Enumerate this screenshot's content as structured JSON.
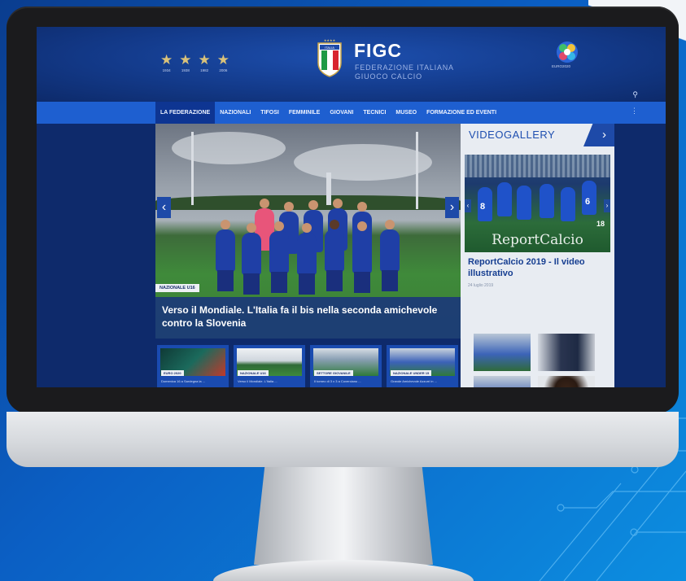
{
  "site": {
    "title": "FIGC",
    "subtitle_line1": "FEDERAZIONE ITALIANA",
    "subtitle_line2": "GIUOCO CALCIO",
    "shield_text": "ITALIA",
    "stars": [
      {
        "year": "1934"
      },
      {
        "year": "1938"
      },
      {
        "year": "1982"
      },
      {
        "year": "2006"
      }
    ],
    "euro_label": "EURO2020",
    "colors": {
      "primary": "#1e5fd0",
      "dark": "#0e2a6b",
      "accent_gold": "#d9c27a"
    }
  },
  "nav": {
    "items": [
      {
        "label": "LA FEDERAZIONE",
        "active": true
      },
      {
        "label": "NAZIONALI",
        "active": false
      },
      {
        "label": "TIFOSI",
        "active": false
      },
      {
        "label": "FEMMINILE",
        "active": false
      },
      {
        "label": "GIOVANI",
        "active": false
      },
      {
        "label": "TECNICI",
        "active": false
      },
      {
        "label": "MUSEO",
        "active": false
      },
      {
        "label": "FORMAZIONE ED EVENTI",
        "active": false
      }
    ],
    "search_icon": "search-icon",
    "menu_icon": "kebab-menu-icon"
  },
  "hero": {
    "tag": "NAZIONALE U16",
    "title": "Verso il Mondiale. L'Italia fa il bis nella seconda amichevole contro la Slovenia"
  },
  "thumbs": [
    {
      "tag": "EURO 2020",
      "text": "Domenica 16 a Sardegna la ..."
    },
    {
      "tag": "NAZIONALE U16",
      "text": "Verso il Mondiale. L'Italia ..."
    },
    {
      "tag": "SETTORE GIOVANILE",
      "text": "Il torneo di 3 x 3 a Coverciano ..."
    },
    {
      "tag": "NAZIONALE UNDER 15",
      "text": "Grande Amichevole Azzurri in ..."
    }
  ],
  "gallery": {
    "title": "VIDEOGALLERY",
    "next_label": "›",
    "overlay_text": "ReportCalcio",
    "video_title": "ReportCalcio 2019 - Il video illustrativo",
    "video_date": "24 luglio 2019",
    "jersey_numbers": [
      "8",
      "6",
      "18"
    ]
  }
}
